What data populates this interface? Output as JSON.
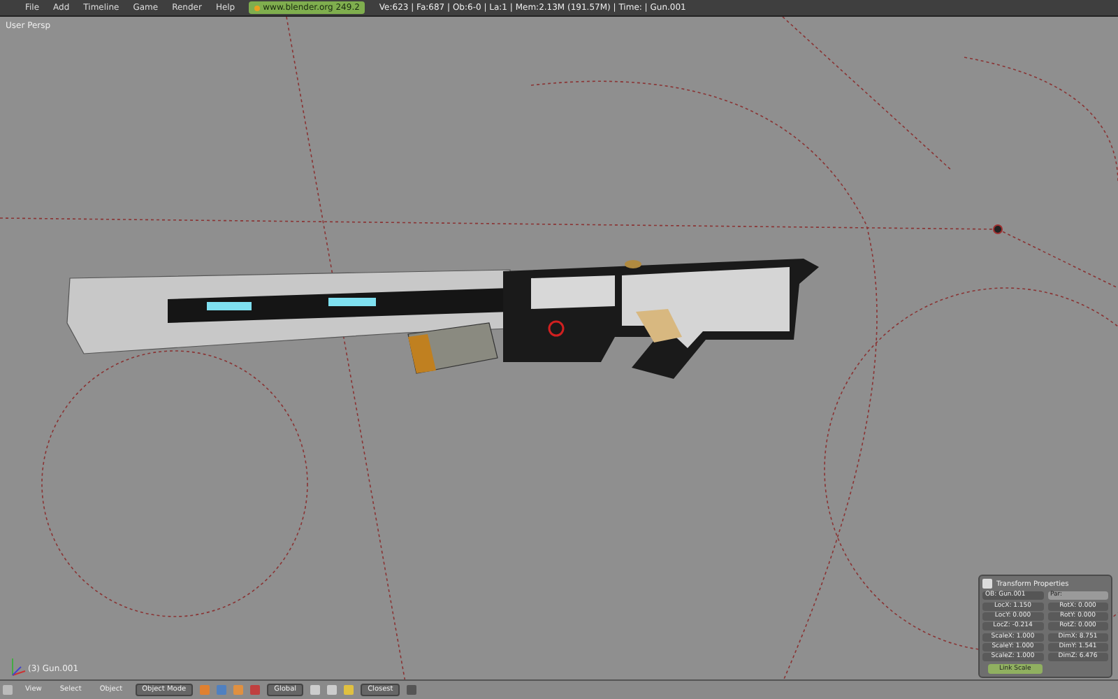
{
  "top_bar": {
    "menu": [
      "File",
      "Add",
      "Timeline",
      "Game",
      "Render",
      "Help"
    ],
    "url": "www.blender.org 249.2",
    "stats": "Ve:623 | Fa:687 | Ob:6-0 | La:1 | Mem:2.13M (191.57M) | Time: | Gun.001"
  },
  "viewport": {
    "view_name": "User Persp",
    "object_label": "(3) Gun.001"
  },
  "transform_panel": {
    "title": "Transform Properties",
    "object_field": "OB: Gun.001",
    "parent_field": "Par:",
    "left_fields": [
      "LocX: 1.150",
      "LocY: 0.000",
      "LocZ: -0.214"
    ],
    "right_fields": [
      "RotX: 0.000",
      "RotY: 0.000",
      "RotZ: 0.000"
    ],
    "scale_fields": [
      "ScaleX: 1.000",
      "ScaleY: 1.000",
      "ScaleZ: 1.000"
    ],
    "dim_fields": [
      "DimX: 8.751",
      "DimY: 1.541",
      "DimZ: 6.476"
    ],
    "link_button": "Link Scale"
  },
  "bottom_bar": {
    "menus": [
      "View",
      "Select",
      "Object"
    ],
    "mode": "Object Mode",
    "orientation": "Global",
    "snap": "Closest"
  }
}
